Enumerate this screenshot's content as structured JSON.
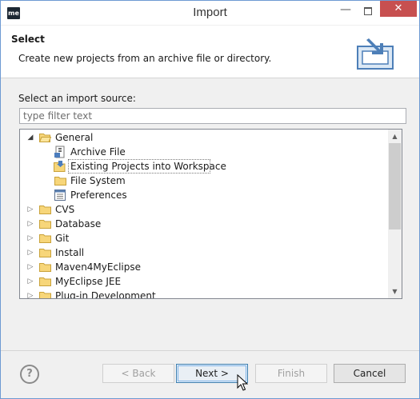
{
  "window": {
    "title": "Import",
    "logo_text": "me",
    "minimize_glyph": "—",
    "close_glyph": "✕"
  },
  "banner": {
    "title": "Select",
    "description": "Create new projects from an archive file or directory."
  },
  "source": {
    "label": "Select an import source:",
    "filter_placeholder": "type filter text",
    "filter_value": ""
  },
  "tree": {
    "items": [
      {
        "label": "General",
        "expanded": true,
        "icon": "folder-icon"
      },
      {
        "label": "Archive File",
        "icon": "archive-file-icon"
      },
      {
        "label": "Existing Projects into Workspace",
        "icon": "existing-projects-icon",
        "selected": true
      },
      {
        "label": "File System",
        "icon": "file-system-icon"
      },
      {
        "label": "Preferences",
        "icon": "preferences-icon"
      },
      {
        "label": "CVS",
        "icon": "folder-icon"
      },
      {
        "label": "Database",
        "icon": "folder-icon"
      },
      {
        "label": "Git",
        "icon": "folder-icon"
      },
      {
        "label": "Install",
        "icon": "folder-icon"
      },
      {
        "label": "Maven4MyEclipse",
        "icon": "folder-icon"
      },
      {
        "label": "MyEclipse JEE",
        "icon": "folder-icon"
      },
      {
        "label": "Plug-in Development",
        "icon": "folder-icon"
      }
    ]
  },
  "footer": {
    "help_glyph": "?",
    "back_label": "< Back",
    "next_label": "Next >",
    "finish_label": "Finish",
    "cancel_label": "Cancel"
  },
  "colors": {
    "close_button": "#c75050",
    "default_button_border": "#3c7fb1",
    "folder": "#e9c46a"
  }
}
